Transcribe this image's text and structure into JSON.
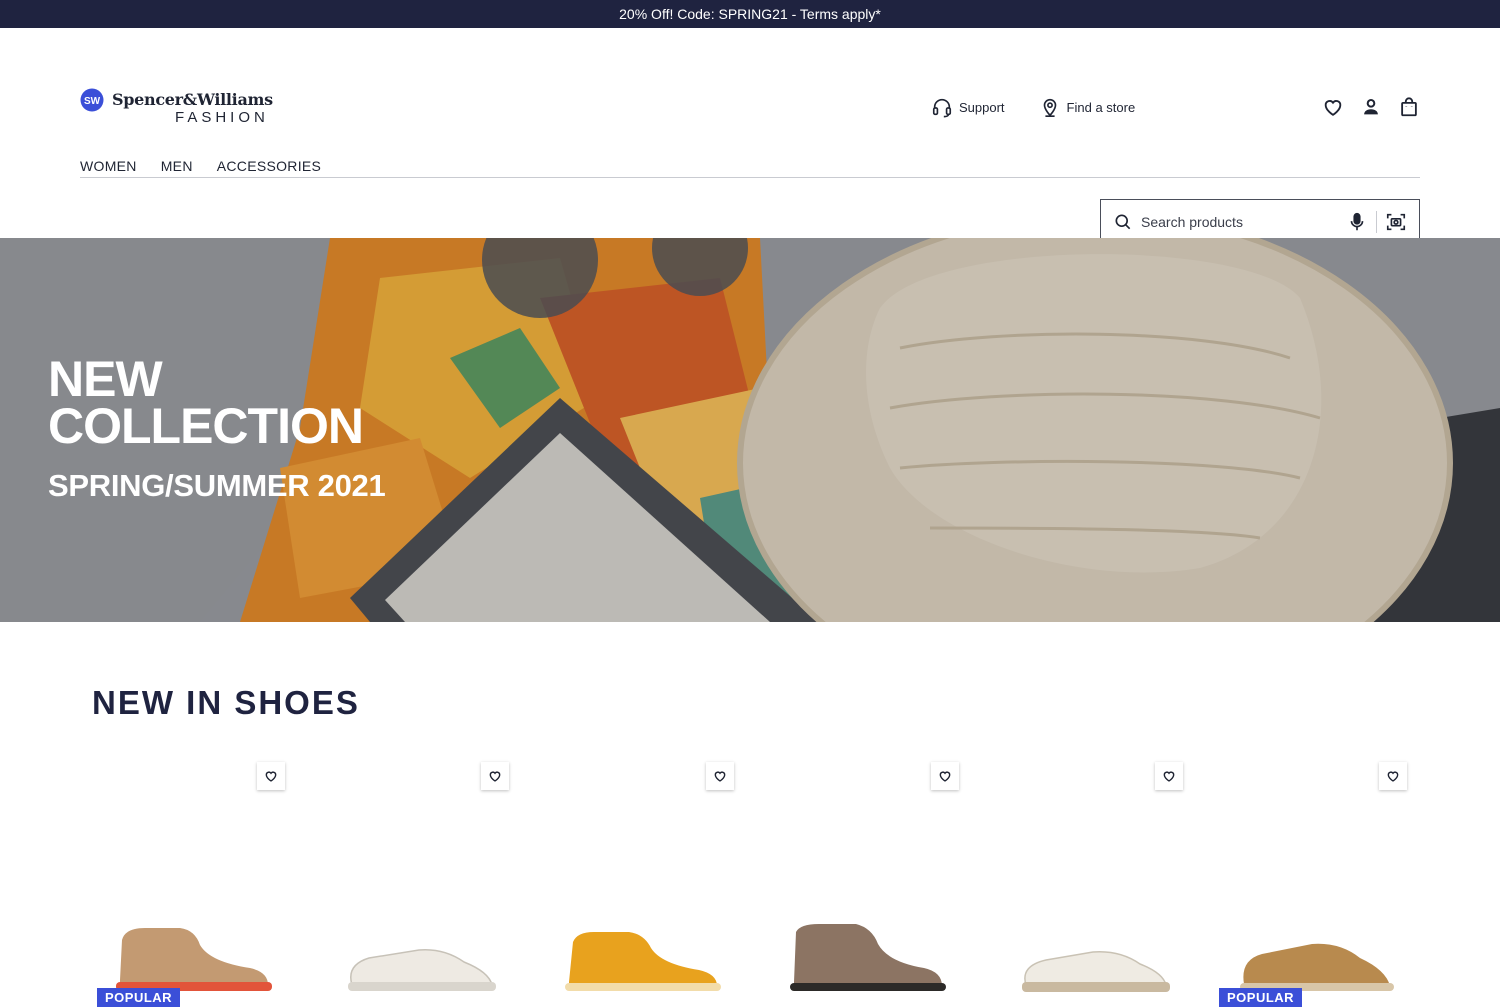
{
  "promo": {
    "text": "20% Off! Code: SPRING21 - Terms apply*"
  },
  "brand": {
    "name": "Spencer&Williams",
    "subtitle": "FASHION",
    "mark": "SW"
  },
  "utility_links": [
    {
      "label": "Support",
      "icon": "headset-icon"
    },
    {
      "label": "Find a store",
      "icon": "map-pin-icon"
    }
  ],
  "header_icons": [
    "heart-icon",
    "user-icon",
    "shopping-bag-icon"
  ],
  "nav": {
    "items": [
      "WOMEN",
      "MEN",
      "ACCESSORIES"
    ]
  },
  "search": {
    "placeholder": "Search products",
    "voice_icon": "microphone-icon",
    "visual_icon": "camera-search-icon"
  },
  "hero": {
    "title": "NEW COLLECTION",
    "subtitle": "SPRING/SUMMER 2021"
  },
  "section": {
    "title": "NEW IN SHOES"
  },
  "products": [
    {
      "badge": "POPULAR",
      "color": "#c39a72",
      "sole": "#e2543a"
    },
    {
      "badge": "",
      "color": "#eeeae3",
      "sole": "#d9d5cd"
    },
    {
      "badge": "",
      "color": "#e8a21e",
      "sole": "#f2dcaa"
    },
    {
      "badge": "",
      "color": "#8c7463",
      "sole": "#2c2a28"
    },
    {
      "badge": "",
      "color": "#efebe3",
      "sole": "#c9b9a0"
    },
    {
      "badge": "POPULAR",
      "color": "#b88a4e",
      "sole": "#d8c6a8"
    }
  ],
  "colors": {
    "promo_bg": "#1f2340",
    "accent": "#3b4fd8",
    "text": "#1f2433"
  }
}
